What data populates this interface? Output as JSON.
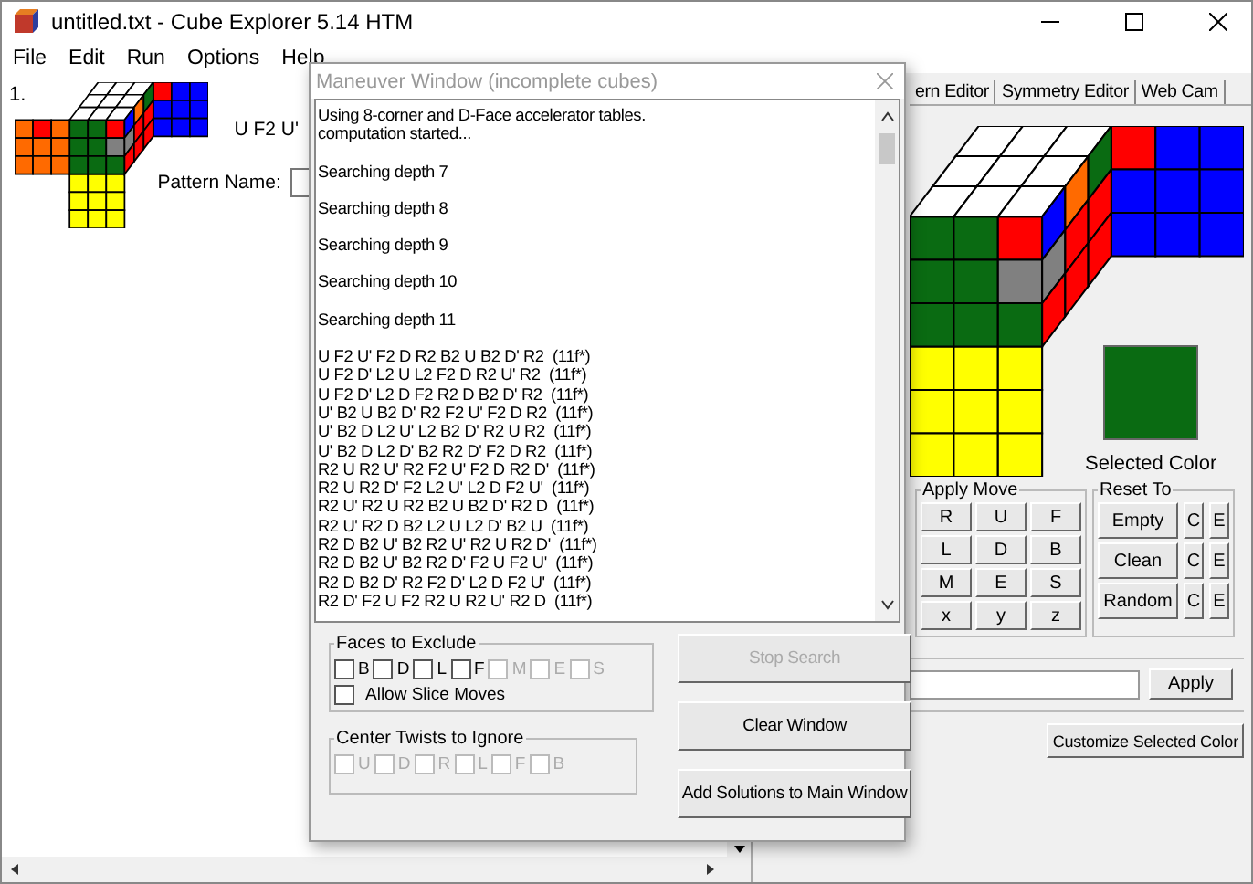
{
  "window": {
    "title": "untitled.txt - Cube Explorer 5.14 HTM"
  },
  "menu": [
    "File",
    "Edit",
    "Run",
    "Options",
    "Help"
  ],
  "pattern": {
    "index": "1.",
    "maneuver": "U F2 U'",
    "name_label": "Pattern Name:"
  },
  "tabs": [
    {
      "label": "ern Editor",
      "selected": false
    },
    {
      "label": "Symmetry Editor",
      "selected": false
    },
    {
      "label": "Web Cam",
      "selected": false
    }
  ],
  "selected_color": {
    "label": "Selected Color",
    "color": "#0a6b12"
  },
  "apply_move": {
    "title": "Apply Move",
    "buttons": [
      "R",
      "U",
      "F",
      "L",
      "D",
      "B",
      "M",
      "E",
      "S",
      "x",
      "y",
      "z"
    ]
  },
  "reset_to": {
    "title": "Reset To",
    "rows": [
      {
        "label": "Empty",
        "c": "C",
        "e": "E"
      },
      {
        "label": "Clean",
        "c": "C",
        "e": "E"
      },
      {
        "label": "Random",
        "c": "C",
        "e": "E"
      }
    ]
  },
  "apply_button": "Apply",
  "customize_button": "Customize Selected Color",
  "dialog": {
    "title": "Maneuver Window (incomplete cubes)",
    "output": [
      [
        "Using 8-corner and D-Face accelerator tables.",
        "computation started..."
      ],
      [
        "Searching depth 7"
      ],
      [
        "Searching depth 8"
      ],
      [
        "Searching depth 9"
      ],
      [
        "Searching depth 10"
      ],
      [
        "Searching depth 11"
      ],
      [
        "U F2 U' F2 D R2 B2 U B2 D' R2  (11f*)",
        "U F2 D' L2 U L2 F2 D R2 U' R2  (11f*)",
        "U F2 D' L2 D F2 R2 D B2 D' R2  (11f*)",
        "U' B2 U B2 D' R2 F2 U' F2 D R2  (11f*)",
        "U' B2 D L2 U' L2 B2 D' R2 U R2  (11f*)",
        "U' B2 D L2 D' B2 R2 D' F2 D R2  (11f*)",
        "R2 U R2 U' R2 F2 U' F2 D R2 D'  (11f*)",
        "R2 U R2 D' F2 L2 U' L2 D F2 U'  (11f*)",
        "R2 U' R2 U R2 B2 U B2 D' R2 D  (11f*)",
        "R2 U' R2 D B2 L2 U L2 D' B2 U  (11f*)",
        "R2 D B2 U' B2 R2 U' R2 U R2 D'  (11f*)",
        "R2 D B2 U' B2 R2 D' F2 U F2 U'  (11f*)",
        "R2 D B2 D' R2 F2 D' L2 D F2 U'  (11f*)",
        "R2 D' F2 U F2 R2 U R2 U' R2 D  (11f*)"
      ]
    ],
    "faces_to_exclude": {
      "title": "Faces to Exclude",
      "faces": [
        {
          "label": "B",
          "checked": false,
          "disabled": false
        },
        {
          "label": "D",
          "checked": false,
          "disabled": false
        },
        {
          "label": "L",
          "checked": false,
          "disabled": false
        },
        {
          "label": "F",
          "checked": false,
          "disabled": false
        },
        {
          "label": "M",
          "checked": false,
          "disabled": true
        },
        {
          "label": "E",
          "checked": false,
          "disabled": true
        },
        {
          "label": "S",
          "checked": false,
          "disabled": true
        }
      ],
      "allow_slice_moves": {
        "label": "Allow Slice Moves",
        "checked": false
      }
    },
    "center_twists": {
      "title": "Center Twists to Ignore",
      "faces": [
        {
          "label": "U",
          "checked": false,
          "disabled": true
        },
        {
          "label": "D",
          "checked": false,
          "disabled": true
        },
        {
          "label": "R",
          "checked": false,
          "disabled": true
        },
        {
          "label": "L",
          "checked": false,
          "disabled": true
        },
        {
          "label": "F",
          "checked": false,
          "disabled": true
        },
        {
          "label": "B",
          "checked": false,
          "disabled": true
        }
      ]
    },
    "buttons": [
      {
        "label": "Stop Search",
        "disabled": true
      },
      {
        "label": "Clear Window",
        "disabled": false
      },
      {
        "label": "Add Solutions to Main Window",
        "disabled": false
      }
    ]
  }
}
